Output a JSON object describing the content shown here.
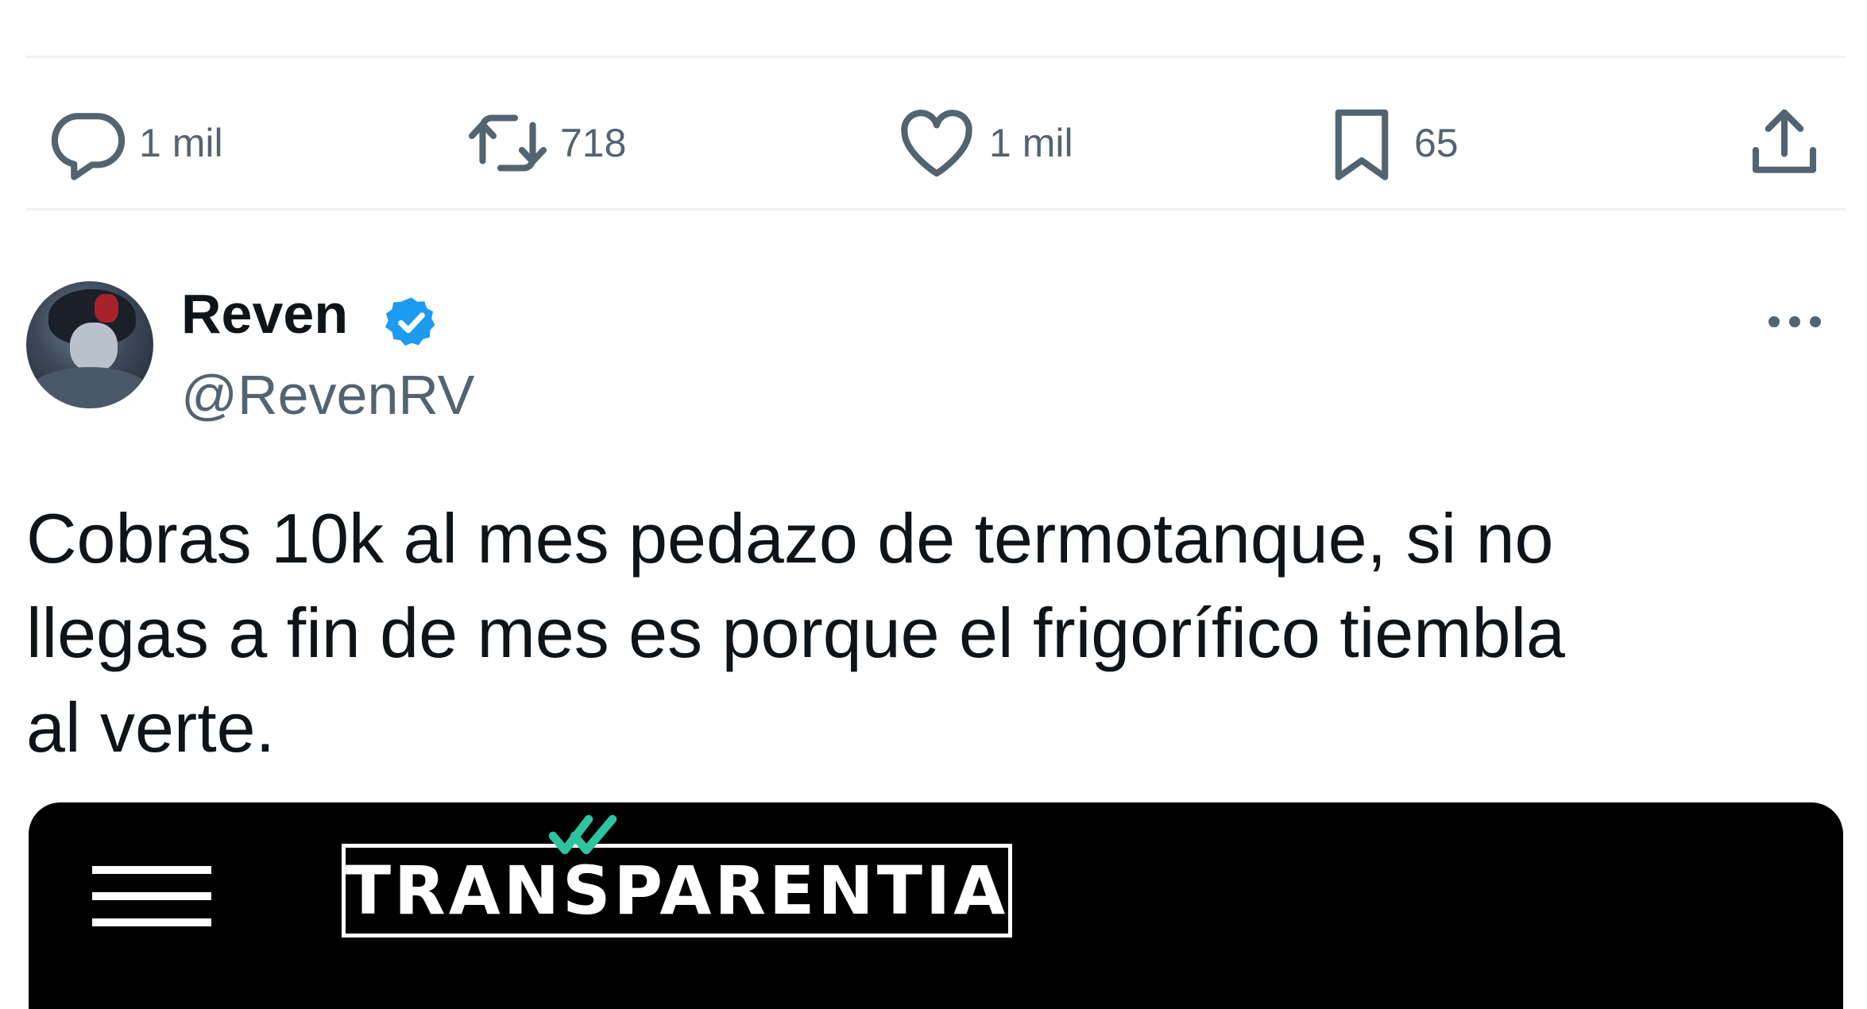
{
  "actions": {
    "reply_count": "1 mil",
    "retweet_count": "718",
    "like_count": "1 mil",
    "bookmark_count": "65"
  },
  "tweet": {
    "display_name": "Reven",
    "handle": "@RevenRV",
    "text": "Cobras 10k al mes pedazo de termotanque, si no\nllegas a fin de mes es porque el frigorífico tiembla\nal verte."
  },
  "media": {
    "logo_text": "TRANSPARENTIA"
  },
  "icons": {
    "reply": "reply-icon",
    "retweet": "retweet-icon",
    "like": "heart-icon",
    "bookmark": "bookmark-icon",
    "share": "share-icon",
    "verified": "verified-badge-icon",
    "more": "more-options-icon",
    "menu": "hamburger-menu-icon"
  },
  "colors": {
    "icon": "#536471",
    "verified": "#1d9bf0",
    "logo_accent": "#2ec4a0"
  }
}
